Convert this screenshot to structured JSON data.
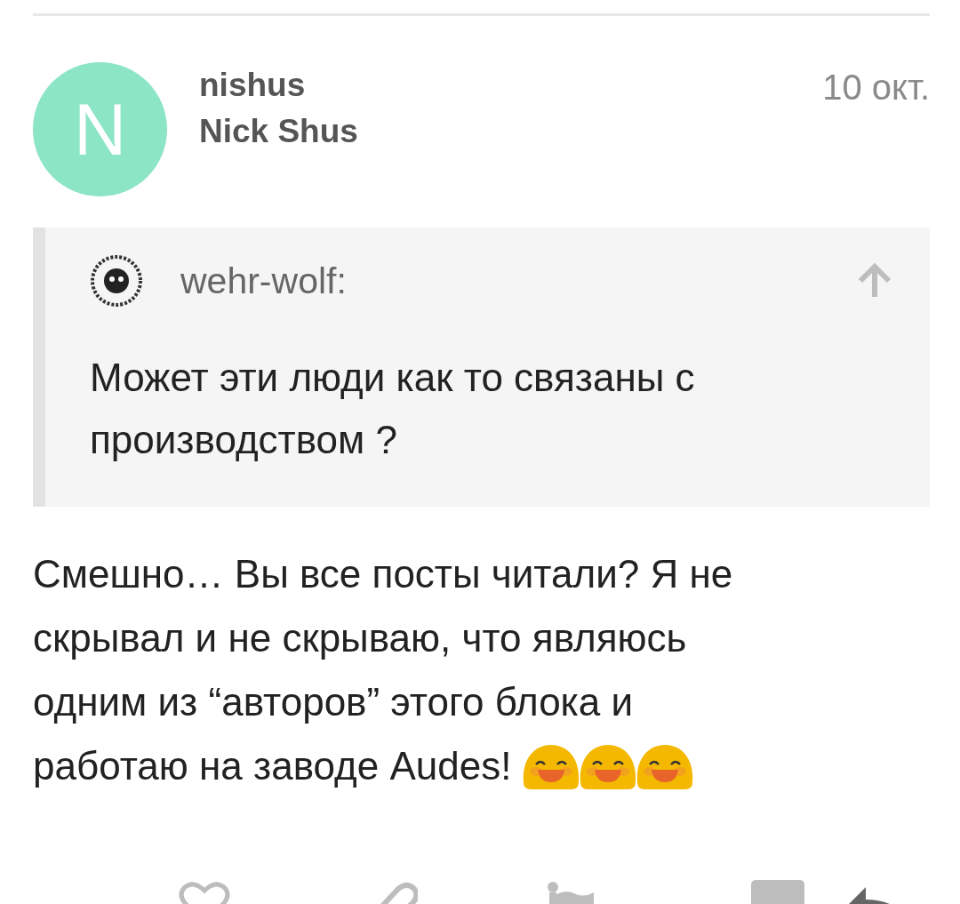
{
  "comment": {
    "avatar_letter": "N",
    "username": "nishus",
    "display_name": "Nick Shus",
    "date": "10 окт."
  },
  "quote": {
    "author": "wehr-wolf:",
    "text": "Может эти люди как то связаны с производством ?"
  },
  "body": {
    "lines": [
      "Смешно… Вы все посты читали? Я не",
      "скрывал и не скрываю, что являюсь",
      "одним из “авторов” этого блока и",
      "работаю на заводе Audes!"
    ]
  }
}
